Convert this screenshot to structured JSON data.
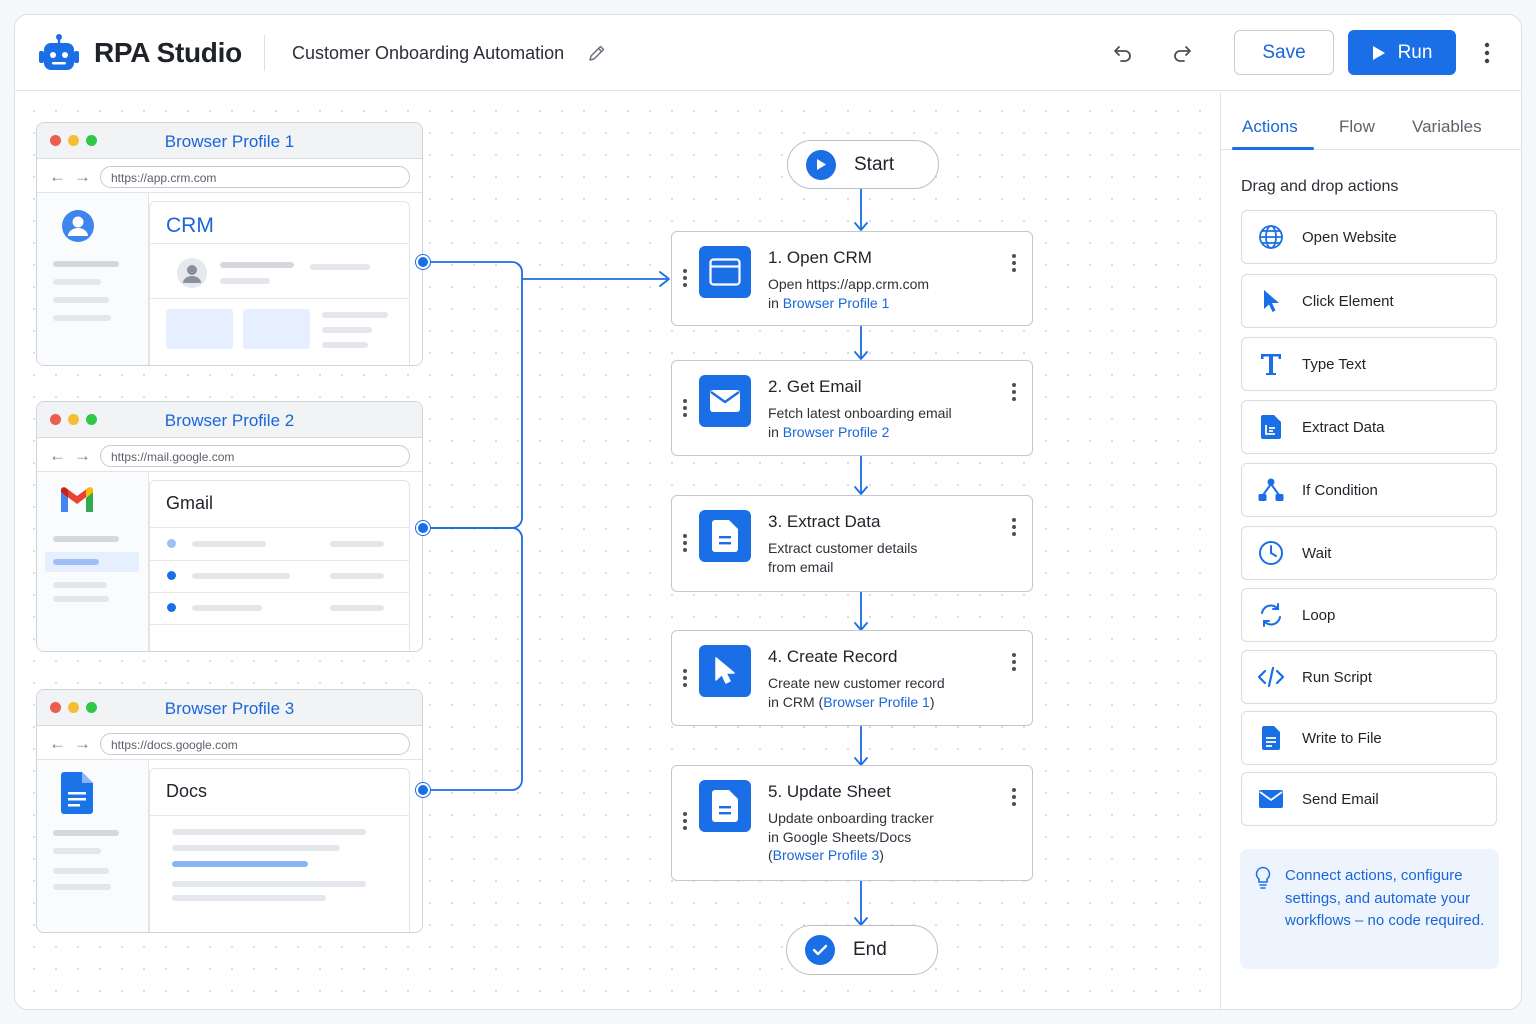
{
  "app": {
    "title": "RPA Studio",
    "document_title": "Customer Onboarding Automation"
  },
  "toolbar": {
    "save_label": "Save",
    "run_label": "Run"
  },
  "browsers": [
    {
      "title": "Browser Profile 1",
      "url": "https://app.crm.com",
      "app_name": "CRM"
    },
    {
      "title": "Browser Profile 2",
      "url": "https://mail.google.com",
      "app_name": "Gmail"
    },
    {
      "title": "Browser Profile 3",
      "url": "https://docs.google.com",
      "app_name": "Docs"
    }
  ],
  "flow": {
    "start_label": "Start",
    "end_label": "End",
    "steps": [
      {
        "title": "1. Open CRM",
        "line1": "Open https://app.crm.com",
        "line2_prefix": "in ",
        "line2_link": "Browser Profile 1",
        "icon": "browser-window-icon"
      },
      {
        "title": "2. Get Email",
        "line1": "Fetch latest onboarding email",
        "line2_prefix": "in ",
        "line2_link": "Browser Profile 2",
        "icon": "envelope-icon"
      },
      {
        "title": "3. Extract Data",
        "line1": "Extract customer details",
        "line2": "from email",
        "icon": "document-icon"
      },
      {
        "title": "4. Create Record",
        "line1": "Create new customer record",
        "line2_prefix": "in CRM (",
        "line2_link": "Browser Profile 1",
        "line2_suffix": ")",
        "icon": "cursor-pointer-icon"
      },
      {
        "title": "5. Update Sheet",
        "line1": "Update onboarding tracker",
        "line2": "in Google Sheets/Docs",
        "line3_prefix": "(",
        "line3_link": "Browser Profile 3",
        "line3_suffix": ")",
        "icon": "document-icon"
      }
    ]
  },
  "panel": {
    "tabs": [
      {
        "label": "Actions",
        "active": true
      },
      {
        "label": "Flow",
        "active": false
      },
      {
        "label": "Variables",
        "active": false
      }
    ],
    "section_label": "Drag and drop actions",
    "actions": [
      {
        "label": "Open Website",
        "icon": "globe-icon"
      },
      {
        "label": "Click Element",
        "icon": "cursor-icon"
      },
      {
        "label": "Type Text",
        "icon": "text-t-icon"
      },
      {
        "label": "Extract Data",
        "icon": "document-extract-icon"
      },
      {
        "label": "If Condition",
        "icon": "branch-icon"
      },
      {
        "label": "Wait",
        "icon": "clock-icon"
      },
      {
        "label": "Loop",
        "icon": "loop-icon"
      },
      {
        "label": "Run Script",
        "icon": "code-icon"
      },
      {
        "label": "Write to File",
        "icon": "file-icon"
      },
      {
        "label": "Send Email",
        "icon": "mail-icon"
      }
    ],
    "tip": "Connect actions, configure settings, and automate your workflows – no code required."
  },
  "colors": {
    "accent": "#1a6ee6",
    "link": "#1a66d8",
    "window_red": "#ee5b4f",
    "window_yellow": "#f5bd2f",
    "window_green": "#33c748"
  }
}
